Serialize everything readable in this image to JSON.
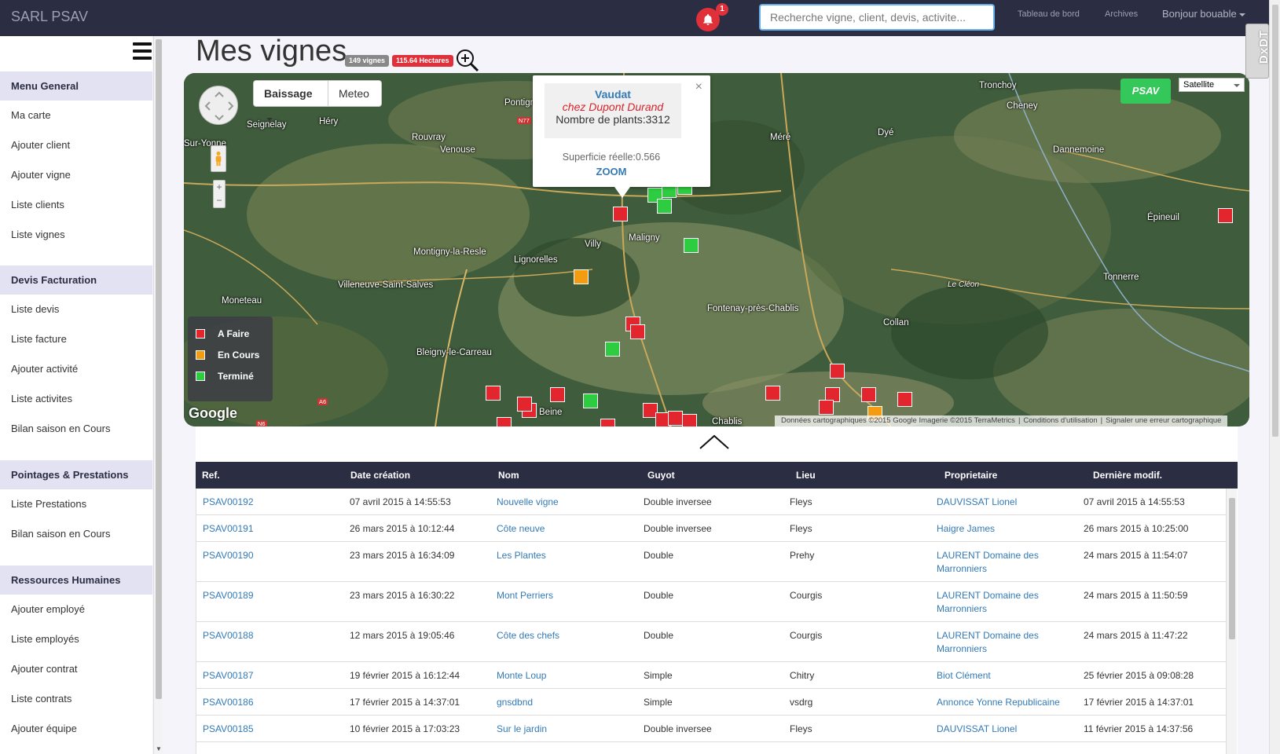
{
  "app": {
    "brand": "SARL PSAV",
    "notifications_count": "1",
    "search_placeholder": "Recherche vigne, client, devis, activite...",
    "nav": {
      "dashboard": "Tableau de bord",
      "archives": "Archives",
      "user": "Bonjour bouable"
    }
  },
  "sidebar": {
    "sections": [
      {
        "title": "Menu General",
        "items": [
          "Ma carte",
          "Ajouter client",
          "Ajouter vigne",
          "Liste clients",
          "Liste vignes"
        ]
      },
      {
        "title": "Devis Facturation",
        "items": [
          "Liste devis",
          "Liste facture",
          "Ajouter activité",
          "Liste activites",
          "Bilan saison en Cours"
        ]
      },
      {
        "title": "Pointages & Prestations",
        "items": [
          "Liste Prestations",
          "Bilan saison en Cours"
        ]
      },
      {
        "title": "Ressources Humaines",
        "items": [
          "Ajouter employé",
          "Liste employés",
          "Ajouter contrat",
          "Liste contrats",
          "Ajouter équipe"
        ]
      }
    ]
  },
  "page": {
    "title": "Mes vignes",
    "badge_count": "149 vignes",
    "badge_area": "115.64 Hectares"
  },
  "map": {
    "mode_button": "Baissage",
    "weather_button": "Meteo",
    "psav_button": "PSAV",
    "map_type": "Satellite",
    "google": "Google",
    "attribution": [
      "Données cartographiques ©2015 Google Imagerie ©2015 TerraMetrics",
      "Conditions d'utilisation",
      "Signaler une erreur cartographique"
    ],
    "legend": [
      {
        "label": "A Faire",
        "color": "#e3262e"
      },
      {
        "label": "En Cours",
        "color": "#f39c12"
      },
      {
        "label": "Terminé",
        "color": "#2ecc40"
      }
    ],
    "places": [
      "Tronchoy",
      "Cheney",
      "Pontigny",
      "Seignelay",
      "Héry",
      "Rouvray",
      "Venouse",
      "Méré",
      "Dyé",
      "Dannemoine",
      "Épineuil",
      "Tonnerre",
      "Montigny-la-Resle",
      "Lignorelles",
      "Villy",
      "Maligny",
      "Villeneuve-Saint-Salves",
      "Moneteau",
      "Fontenay-près-Chablis",
      "Collan",
      "Bleigny-le-Carreau",
      "Beine",
      "Chablis",
      "Le Cléon",
      "Sur-Yonne"
    ],
    "roads": [
      "N77",
      "A6",
      "N6"
    ],
    "popup": {
      "title": "Vaudat",
      "owner": "chez Dupont Durand",
      "plants": "Nombre de plants:3312",
      "area": "Superficie réelle:0.566",
      "zoom": "ZOOM",
      "close": "×"
    }
  },
  "table": {
    "columns": [
      "Ref.",
      "Date création",
      "Nom",
      "Guyot",
      "Lieu",
      "Proprietaire",
      "Dernière modif."
    ],
    "rows": [
      {
        "ref": "PSAV00192",
        "created": "07 avril 2015 à 14:55:53",
        "name": "Nouvelle vigne",
        "guyot": "Double inversee",
        "place": "Fleys",
        "owner": "DAUVISSAT Lionel",
        "modified": "07 avril 2015 à 14:55:53"
      },
      {
        "ref": "PSAV00191",
        "created": "26 mars 2015 à 10:12:44",
        "name": "Côte neuve",
        "guyot": "Double inversee",
        "place": "Fleys",
        "owner": "Haigre James",
        "modified": "26 mars 2015 à 10:25:00"
      },
      {
        "ref": "PSAV00190",
        "created": "23 mars 2015 à 16:34:09",
        "name": "Les Plantes",
        "guyot": "Double",
        "place": "Prehy",
        "owner": "LAURENT Domaine des Marronniers",
        "modified": "24 mars 2015 à 11:54:07"
      },
      {
        "ref": "PSAV00189",
        "created": "23 mars 2015 à 16:30:22",
        "name": "Mont Perriers",
        "guyot": "Double",
        "place": "Courgis",
        "owner": "LAURENT Domaine des Marronniers",
        "modified": "24 mars 2015 à 11:50:59"
      },
      {
        "ref": "PSAV00188",
        "created": "12 mars 2015 à 19:05:46",
        "name": "Côte des chefs",
        "guyot": "Double",
        "place": "Courgis",
        "owner": "LAURENT Domaine des Marronniers",
        "modified": "24 mars 2015 à 11:47:22"
      },
      {
        "ref": "PSAV00187",
        "created": "19 février 2015 à 16:12:44",
        "name": "Monte Loup",
        "guyot": "Simple",
        "place": "Chitry",
        "owner": "Biot Clément",
        "modified": "25 février 2015 à 09:08:28"
      },
      {
        "ref": "PSAV00186",
        "created": "17 février 2015 à 14:37:01",
        "name": "gnsdbnd",
        "guyot": "Simple",
        "place": "vsdrg",
        "owner": "Annonce Yonne Republicaine",
        "modified": "17 février 2015 à 14:37:01"
      },
      {
        "ref": "PSAV00185",
        "created": "10 février 2015 à 17:03:23",
        "name": "Sur le jardin",
        "guyot": "Double inversee",
        "place": "Fleys",
        "owner": "DAUVISSAT Lionel",
        "modified": "11 février 2015 à 14:37:56"
      }
    ]
  },
  "extension": {
    "label": "DxDT"
  },
  "colors": {
    "navbar": "#2b2d42",
    "accent": "#337ab7",
    "todo": "#e3262e",
    "in_progress": "#f39c12",
    "done": "#2ecc40"
  }
}
